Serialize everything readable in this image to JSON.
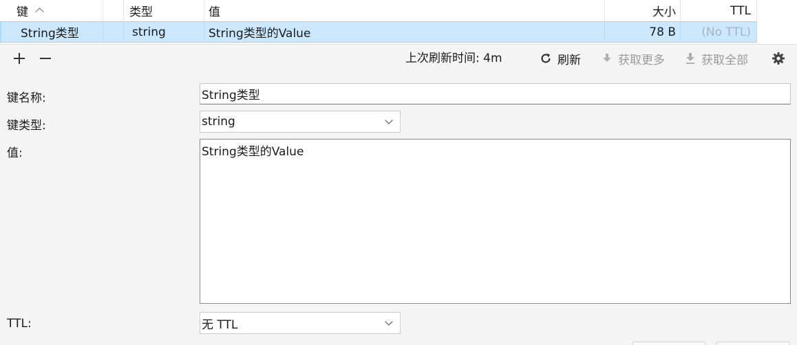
{
  "table": {
    "headers": {
      "key": "键",
      "type": "类型",
      "value": "值",
      "size": "大小",
      "ttl": "TTL"
    },
    "row": {
      "key": "String类型",
      "type": "string",
      "value": "String类型的Value",
      "size": "78 B",
      "ttl": "(No TTL)"
    }
  },
  "toolbar": {
    "refresh_time": "上次刷新时间: 4m",
    "refresh_label": "刷新",
    "fetch_more_label": "获取更多",
    "fetch_all_label": "获取全部"
  },
  "form": {
    "name_label": "键名称:",
    "name_value": "String类型",
    "type_label": "键类型:",
    "type_value": "string",
    "value_label": "值:",
    "value_text": "String类型的Value",
    "ttl_label": "TTL:",
    "ttl_value": "无 TTL"
  },
  "colors": {
    "selection": "#cce8ff",
    "selection_border": "#99d1ff",
    "disabled_text": "#9a9a9a",
    "panel_bg": "#f5f5f5"
  },
  "icons": {
    "add": "plus-icon",
    "remove": "minus-icon",
    "refresh": "refresh-icon",
    "fetch_more": "arrow-down-icon",
    "fetch_all": "download-icon",
    "settings": "gear-icon",
    "sort": "chevron-up-icon",
    "dropdown": "chevron-down-icon"
  }
}
